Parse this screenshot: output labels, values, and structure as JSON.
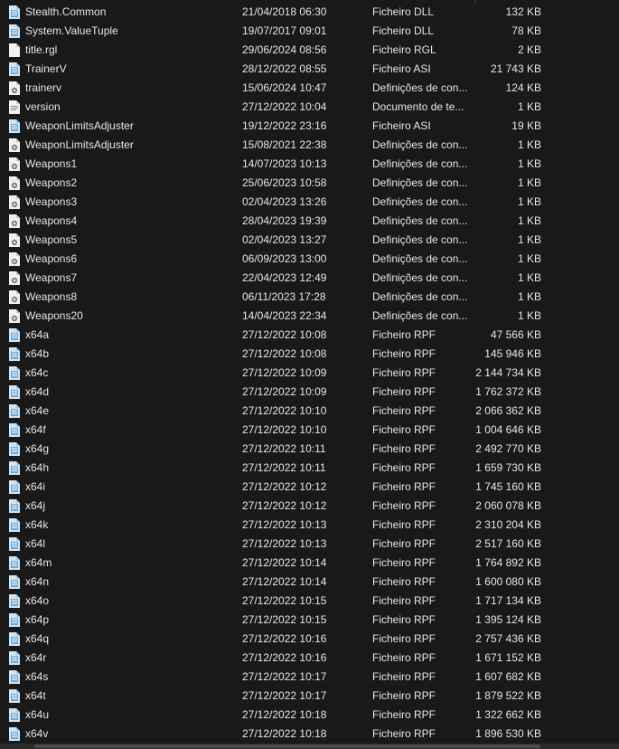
{
  "files": [
    {
      "name": "Stealth.Common",
      "date": "21/04/2018 06:30",
      "type": "Ficheiro DLL",
      "size": "132 KB",
      "icon": "dll-file-icon"
    },
    {
      "name": "System.ValueTuple",
      "date": "19/07/2017 09:01",
      "type": "Ficheiro DLL",
      "size": "78 KB",
      "icon": "dll-file-icon"
    },
    {
      "name": "title.rgl",
      "date": "29/06/2024 08:56",
      "type": "Ficheiro RGL",
      "size": "2 KB",
      "icon": "blank-file-icon"
    },
    {
      "name": "TrainerV",
      "date": "28/12/2022 08:55",
      "type": "Ficheiro ASI",
      "size": "21 743 KB",
      "icon": "asi-file-icon"
    },
    {
      "name": "trainerv",
      "date": "15/06/2024 10:47",
      "type": "Definições de con...",
      "size": "124 KB",
      "icon": "config-file-icon"
    },
    {
      "name": "version",
      "date": "27/12/2022 10:04",
      "type": "Documento de te...",
      "size": "1 KB",
      "icon": "text-file-icon"
    },
    {
      "name": "WeaponLimitsAdjuster",
      "date": "19/12/2022 23:16",
      "type": "Ficheiro ASI",
      "size": "19 KB",
      "icon": "asi-file-icon"
    },
    {
      "name": "WeaponLimitsAdjuster",
      "date": "15/08/2021 22:38",
      "type": "Definições de con...",
      "size": "1 KB",
      "icon": "config-file-icon"
    },
    {
      "name": "Weapons1",
      "date": "14/07/2023 10:13",
      "type": "Definições de con...",
      "size": "1 KB",
      "icon": "config-file-icon"
    },
    {
      "name": "Weapons2",
      "date": "25/06/2023 10:58",
      "type": "Definições de con...",
      "size": "1 KB",
      "icon": "config-file-icon"
    },
    {
      "name": "Weapons3",
      "date": "02/04/2023 13:26",
      "type": "Definições de con...",
      "size": "1 KB",
      "icon": "config-file-icon"
    },
    {
      "name": "Weapons4",
      "date": "28/04/2023 19:39",
      "type": "Definições de con...",
      "size": "1 KB",
      "icon": "config-file-icon"
    },
    {
      "name": "Weapons5",
      "date": "02/04/2023 13:27",
      "type": "Definições de con...",
      "size": "1 KB",
      "icon": "config-file-icon"
    },
    {
      "name": "Weapons6",
      "date": "06/09/2023 13:00",
      "type": "Definições de con...",
      "size": "1 KB",
      "icon": "config-file-icon"
    },
    {
      "name": "Weapons7",
      "date": "22/04/2023 12:49",
      "type": "Definições de con...",
      "size": "1 KB",
      "icon": "config-file-icon"
    },
    {
      "name": "Weapons8",
      "date": "06/11/2023 17:28",
      "type": "Definições de con...",
      "size": "1 KB",
      "icon": "config-file-icon"
    },
    {
      "name": "Weapons20",
      "date": "14/04/2023 22:34",
      "type": "Definições de con...",
      "size": "1 KB",
      "icon": "config-file-icon"
    },
    {
      "name": "x64a",
      "date": "27/12/2022 10:08",
      "type": "Ficheiro RPF",
      "size": "47 566 KB",
      "icon": "rpf-file-icon"
    },
    {
      "name": "x64b",
      "date": "27/12/2022 10:08",
      "type": "Ficheiro RPF",
      "size": "145 946 KB",
      "icon": "rpf-file-icon"
    },
    {
      "name": "x64c",
      "date": "27/12/2022 10:09",
      "type": "Ficheiro RPF",
      "size": "2 144 734 KB",
      "icon": "rpf-file-icon"
    },
    {
      "name": "x64d",
      "date": "27/12/2022 10:09",
      "type": "Ficheiro RPF",
      "size": "1 762 372 KB",
      "icon": "rpf-file-icon"
    },
    {
      "name": "x64e",
      "date": "27/12/2022 10:10",
      "type": "Ficheiro RPF",
      "size": "2 066 362 KB",
      "icon": "rpf-file-icon"
    },
    {
      "name": "x64f",
      "date": "27/12/2022 10:10",
      "type": "Ficheiro RPF",
      "size": "1 004 646 KB",
      "icon": "rpf-file-icon"
    },
    {
      "name": "x64g",
      "date": "27/12/2022 10:11",
      "type": "Ficheiro RPF",
      "size": "2 492 770 KB",
      "icon": "rpf-file-icon"
    },
    {
      "name": "x64h",
      "date": "27/12/2022 10:11",
      "type": "Ficheiro RPF",
      "size": "1 659 730 KB",
      "icon": "rpf-file-icon"
    },
    {
      "name": "x64i",
      "date": "27/12/2022 10:12",
      "type": "Ficheiro RPF",
      "size": "1 745 160 KB",
      "icon": "rpf-file-icon"
    },
    {
      "name": "x64j",
      "date": "27/12/2022 10:12",
      "type": "Ficheiro RPF",
      "size": "2 060 078 KB",
      "icon": "rpf-file-icon"
    },
    {
      "name": "x64k",
      "date": "27/12/2022 10:13",
      "type": "Ficheiro RPF",
      "size": "2 310 204 KB",
      "icon": "rpf-file-icon"
    },
    {
      "name": "x64l",
      "date": "27/12/2022 10:13",
      "type": "Ficheiro RPF",
      "size": "2 517 160 KB",
      "icon": "rpf-file-icon"
    },
    {
      "name": "x64m",
      "date": "27/12/2022 10:14",
      "type": "Ficheiro RPF",
      "size": "1 764 892 KB",
      "icon": "rpf-file-icon"
    },
    {
      "name": "x64n",
      "date": "27/12/2022 10:14",
      "type": "Ficheiro RPF",
      "size": "1 600 080 KB",
      "icon": "rpf-file-icon"
    },
    {
      "name": "x64o",
      "date": "27/12/2022 10:15",
      "type": "Ficheiro RPF",
      "size": "1 717 134 KB",
      "icon": "rpf-file-icon"
    },
    {
      "name": "x64p",
      "date": "27/12/2022 10:15",
      "type": "Ficheiro RPF",
      "size": "1 395 124 KB",
      "icon": "rpf-file-icon"
    },
    {
      "name": "x64q",
      "date": "27/12/2022 10:16",
      "type": "Ficheiro RPF",
      "size": "2 757 436 KB",
      "icon": "rpf-file-icon"
    },
    {
      "name": "x64r",
      "date": "27/12/2022 10:16",
      "type": "Ficheiro RPF",
      "size": "1 671 152 KB",
      "icon": "rpf-file-icon"
    },
    {
      "name": "x64s",
      "date": "27/12/2022 10:17",
      "type": "Ficheiro RPF",
      "size": "1 607 682 KB",
      "icon": "rpf-file-icon"
    },
    {
      "name": "x64t",
      "date": "27/12/2022 10:17",
      "type": "Ficheiro RPF",
      "size": "1 879 522 KB",
      "icon": "rpf-file-icon"
    },
    {
      "name": "x64u",
      "date": "27/12/2022 10:18",
      "type": "Ficheiro RPF",
      "size": "1 322 662 KB",
      "icon": "rpf-file-icon"
    },
    {
      "name": "x64v",
      "date": "27/12/2022 10:18",
      "type": "Ficheiro RPF",
      "size": "1 896 530 KB",
      "icon": "rpf-file-icon"
    }
  ],
  "colors": {
    "background": "#191919",
    "text": "#e6e6e6",
    "icon_blue": "#8ec5e8",
    "icon_white": "#f2f2f2"
  }
}
